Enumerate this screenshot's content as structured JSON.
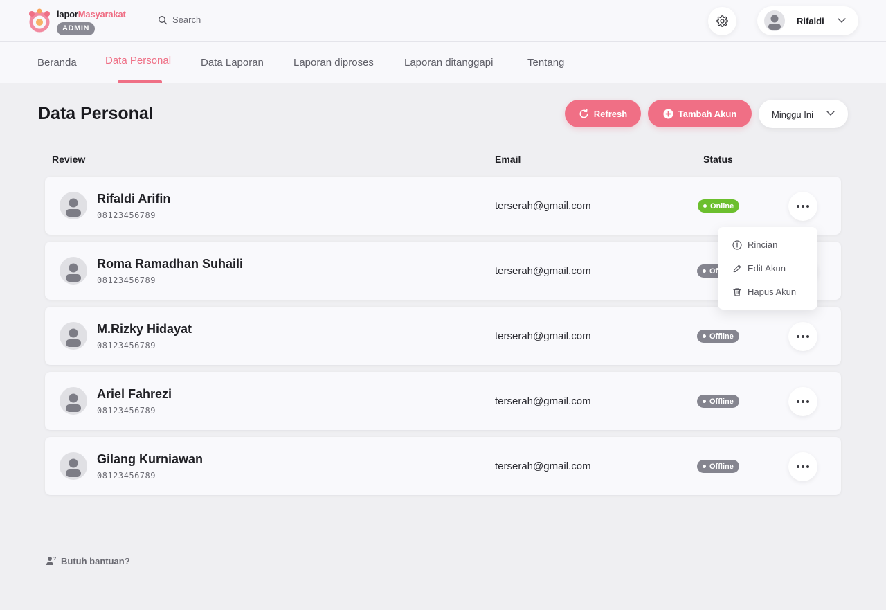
{
  "brand": {
    "part1": "lapor",
    "part2": "Masyarakat",
    "role_badge": "ADMIN"
  },
  "search": {
    "placeholder": "Search"
  },
  "user": {
    "name": "Rifaldi"
  },
  "nav": {
    "tabs": [
      {
        "label": "Beranda"
      },
      {
        "label": "Data Personal",
        "active": true
      },
      {
        "label": "Data Laporan"
      },
      {
        "label": "Laporan diproses"
      },
      {
        "label": "Laporan ditanggapi"
      },
      {
        "label": "Tentang"
      }
    ]
  },
  "page": {
    "title": "Data Personal"
  },
  "actions": {
    "refresh_label": "Refresh",
    "add_label": "Tambah Akun",
    "period_label": "Minggu Ini"
  },
  "table": {
    "headers": {
      "review": "Review",
      "email": "Email",
      "status": "Status"
    },
    "rows": [
      {
        "name": "Rifaldi Arifin",
        "phone": "08123456789",
        "email": "terserah@gmail.com",
        "status": "Online"
      },
      {
        "name": "Roma Ramadhan Suhaili",
        "phone": "08123456789",
        "email": "terserah@gmail.com",
        "status": "Offline"
      },
      {
        "name": "M.Rizky Hidayat",
        "phone": "08123456789",
        "email": "terserah@gmail.com",
        "status": "Offline"
      },
      {
        "name": "Ariel Fahrezi",
        "phone": "08123456789",
        "email": "terserah@gmail.com",
        "status": "Offline"
      },
      {
        "name": "Gilang Kurniawan",
        "phone": "08123456789",
        "email": "terserah@gmail.com",
        "status": "Offline"
      }
    ]
  },
  "context_menu": {
    "items": [
      {
        "label": "Rincian",
        "icon": "info-icon"
      },
      {
        "label": "Edit Akun",
        "icon": "pencil-icon"
      },
      {
        "label": "Hapus Akun",
        "icon": "trash-icon"
      }
    ]
  },
  "help": {
    "label": "Butuh bantuan?"
  },
  "colors": {
    "accent": "#f06f85",
    "online": "#6cbf2e",
    "offline": "#85858f",
    "badge": "#8a8a94"
  }
}
